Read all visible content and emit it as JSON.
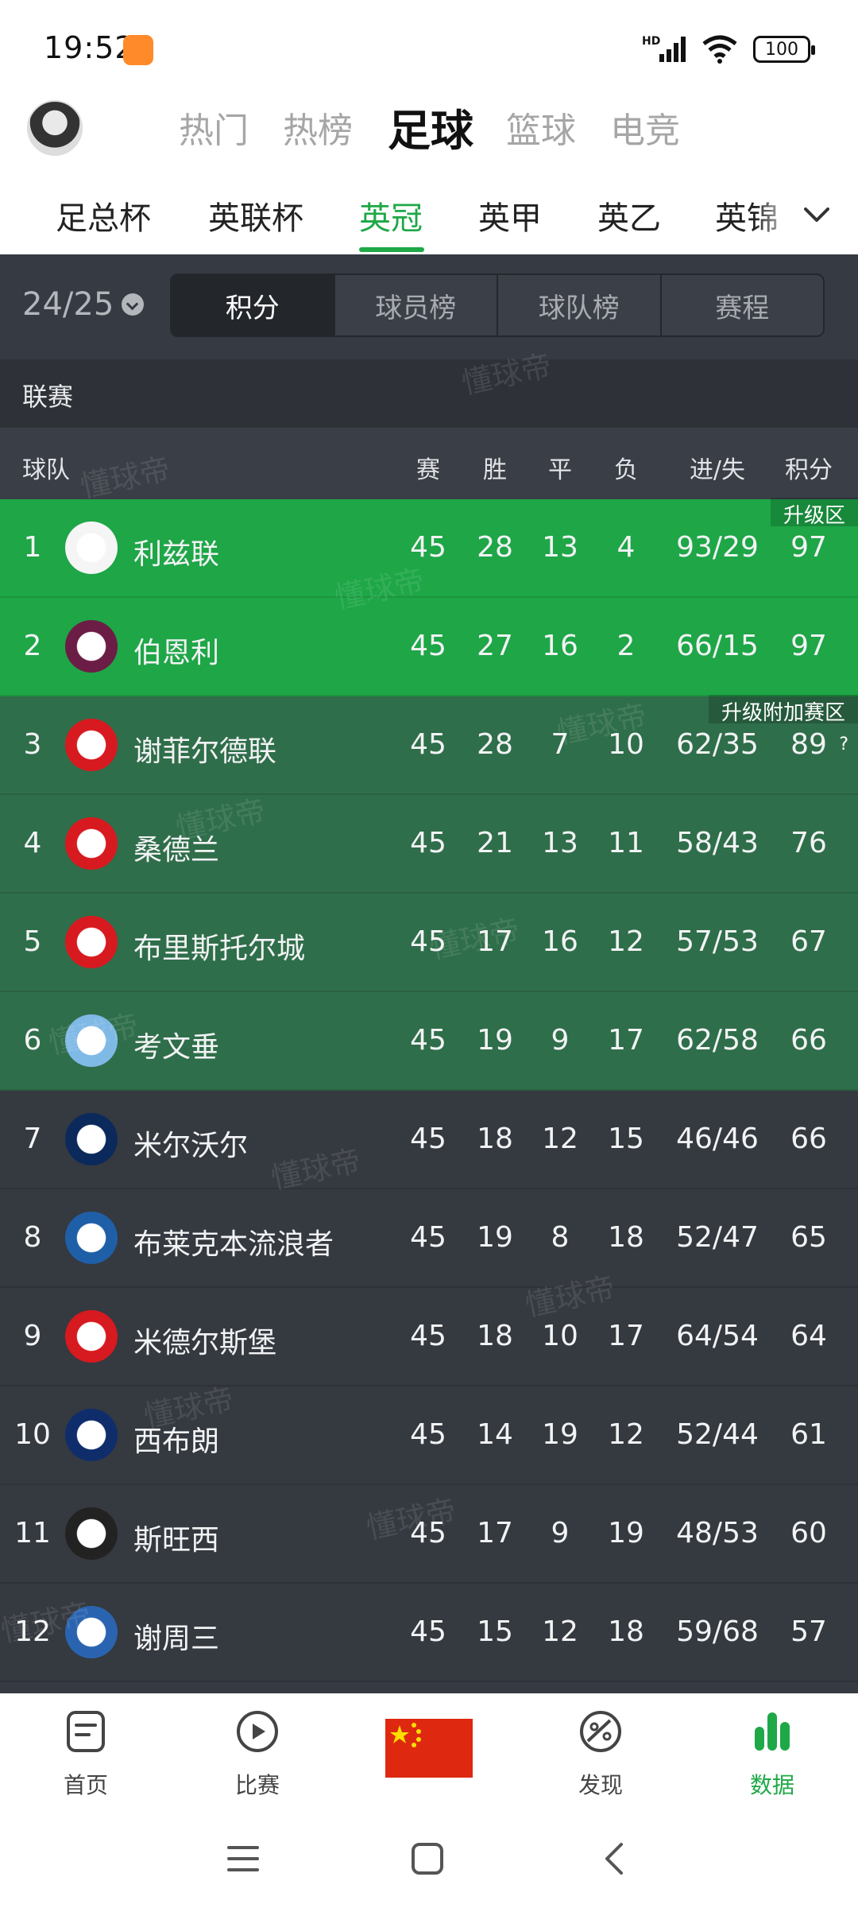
{
  "status": {
    "time": "19:52",
    "battery": "100",
    "network": "HD"
  },
  "main_tabs": [
    {
      "label": "热门"
    },
    {
      "label": "热榜"
    },
    {
      "label": "足球"
    },
    {
      "label": "篮球"
    },
    {
      "label": "电竞"
    }
  ],
  "league_tabs": [
    {
      "label": "足总杯"
    },
    {
      "label": "英联杯"
    },
    {
      "label": "英冠"
    },
    {
      "label": "英甲"
    },
    {
      "label": "英乙"
    },
    {
      "label": "英锦"
    }
  ],
  "season": "24/25",
  "segments": [
    "积分",
    "球员榜",
    "球队榜",
    "赛程"
  ],
  "section_title": "联赛",
  "columns": {
    "team": "球队",
    "played": "赛",
    "won": "胜",
    "drawn": "平",
    "lost": "负",
    "goals": "进/失",
    "points": "积分"
  },
  "zones": {
    "promotion": "升级区",
    "playoff": "升级附加赛区"
  },
  "help_mark": "?",
  "rows": [
    {
      "rank": "1",
      "team": "利兹联",
      "played": "45",
      "won": "28",
      "drawn": "13",
      "lost": "4",
      "goals": "93/29",
      "points": "97",
      "zone": "promotion"
    },
    {
      "rank": "2",
      "team": "伯恩利",
      "played": "45",
      "won": "27",
      "drawn": "16",
      "lost": "2",
      "goals": "66/15",
      "points": "97",
      "zone": "promotion"
    },
    {
      "rank": "3",
      "team": "谢菲尔德联",
      "played": "45",
      "won": "28",
      "drawn": "7",
      "lost": "10",
      "goals": "62/35",
      "points": "89",
      "zone": "playoff"
    },
    {
      "rank": "4",
      "team": "桑德兰",
      "played": "45",
      "won": "21",
      "drawn": "13",
      "lost": "11",
      "goals": "58/43",
      "points": "76",
      "zone": "playoff"
    },
    {
      "rank": "5",
      "team": "布里斯托尔城",
      "played": "45",
      "won": "17",
      "drawn": "16",
      "lost": "12",
      "goals": "57/53",
      "points": "67",
      "zone": "playoff"
    },
    {
      "rank": "6",
      "team": "考文垂",
      "played": "45",
      "won": "19",
      "drawn": "9",
      "lost": "17",
      "goals": "62/58",
      "points": "66",
      "zone": "playoff"
    },
    {
      "rank": "7",
      "team": "米尔沃尔",
      "played": "45",
      "won": "18",
      "drawn": "12",
      "lost": "15",
      "goals": "46/46",
      "points": "66",
      "zone": ""
    },
    {
      "rank": "8",
      "team": "布莱克本流浪者",
      "played": "45",
      "won": "19",
      "drawn": "8",
      "lost": "18",
      "goals": "52/47",
      "points": "65",
      "zone": ""
    },
    {
      "rank": "9",
      "team": "米德尔斯堡",
      "played": "45",
      "won": "18",
      "drawn": "10",
      "lost": "17",
      "goals": "64/54",
      "points": "64",
      "zone": ""
    },
    {
      "rank": "10",
      "team": "西布朗",
      "played": "45",
      "won": "14",
      "drawn": "19",
      "lost": "12",
      "goals": "52/44",
      "points": "61",
      "zone": ""
    },
    {
      "rank": "11",
      "team": "斯旺西",
      "played": "45",
      "won": "17",
      "drawn": "9",
      "lost": "19",
      "goals": "48/53",
      "points": "60",
      "zone": ""
    },
    {
      "rank": "12",
      "team": "谢周三",
      "played": "45",
      "won": "15",
      "drawn": "12",
      "lost": "18",
      "goals": "59/68",
      "points": "57",
      "zone": ""
    }
  ],
  "watermark": "懂球帝",
  "bottom_nav": [
    {
      "label": "首页"
    },
    {
      "label": "比赛"
    },
    {
      "label": ""
    },
    {
      "label": "发现"
    },
    {
      "label": "数据"
    }
  ],
  "colors": {
    "accent": "#1fa847",
    "promotion": "#1ea647",
    "playoff": "#2f6e4a",
    "panel": "#363a42"
  }
}
